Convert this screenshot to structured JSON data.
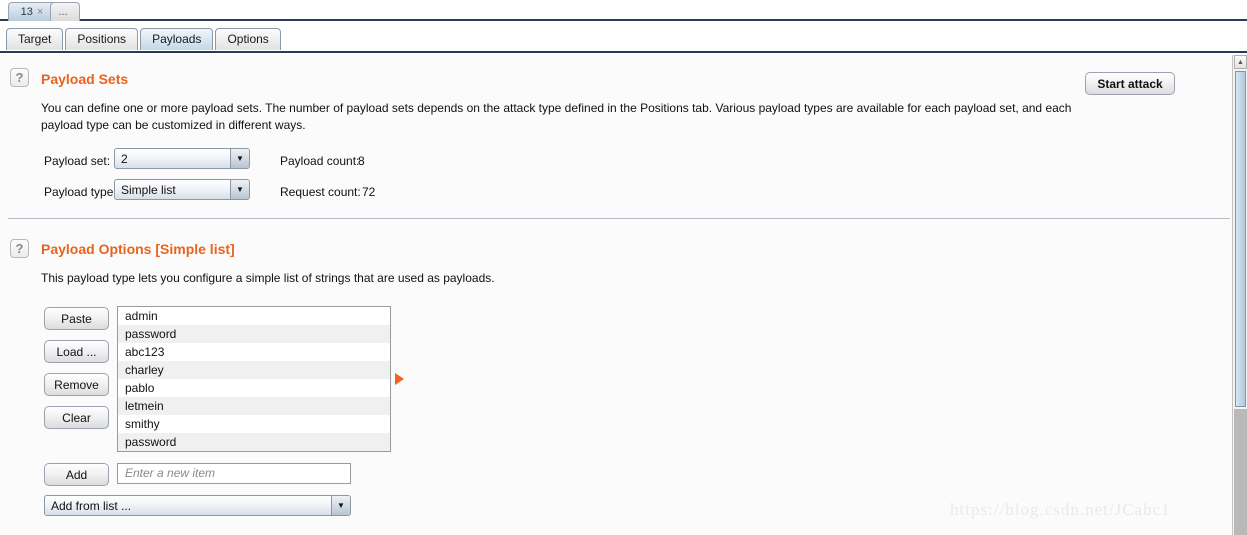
{
  "window_tabs": [
    {
      "label": "13",
      "close": "×",
      "active": true
    },
    {
      "label": "...",
      "active": false
    }
  ],
  "inner_tabs": [
    {
      "label": "Target",
      "active": false
    },
    {
      "label": "Positions",
      "active": false
    },
    {
      "label": "Payloads",
      "active": true
    },
    {
      "label": "Options",
      "active": false
    }
  ],
  "toolbar": {
    "start_attack_label": "Start attack"
  },
  "payload_sets": {
    "help_glyph": "?",
    "title": "Payload Sets",
    "description": "You can define one or more payload sets. The number of payload sets depends on the attack type defined in the Positions tab. Various payload types are available for each payload set, and each payload type can be customized in different ways.",
    "payload_set_label": "Payload set:",
    "payload_set_value": "2",
    "payload_type_label": "Payload type:",
    "payload_type_value": "Simple list",
    "payload_count_label": "Payload count:",
    "payload_count_value": "8",
    "request_count_label": "Request count:",
    "request_count_value": "72",
    "arrow_glyph": "▼"
  },
  "payload_options": {
    "help_glyph": "?",
    "title": "Payload Options [Simple list]",
    "description": "This payload type lets you configure a simple list of strings that are used as payloads.",
    "buttons": [
      {
        "label": "Paste"
      },
      {
        "label": "Load ..."
      },
      {
        "label": "Remove"
      },
      {
        "label": "Clear"
      }
    ],
    "items": [
      "admin",
      "password",
      "abc123",
      "charley",
      "pablo",
      "letmein",
      "smithy",
      "password"
    ],
    "add_button_label": "Add",
    "new_item_placeholder": "Enter a new item",
    "add_from_list_label": "Add from list ...",
    "add_from_list_arrow": "▼"
  },
  "scrollbar": {
    "up_arrow_glyph": "▲"
  },
  "watermark": "https://blog.csdn.net/JCabc1",
  "colors": {
    "accent_orange": "#e8641c",
    "pointer_orange": "#f4621f",
    "tab_active_blue": "#c3d8ea",
    "panel_bg": "#fbfbfb"
  }
}
